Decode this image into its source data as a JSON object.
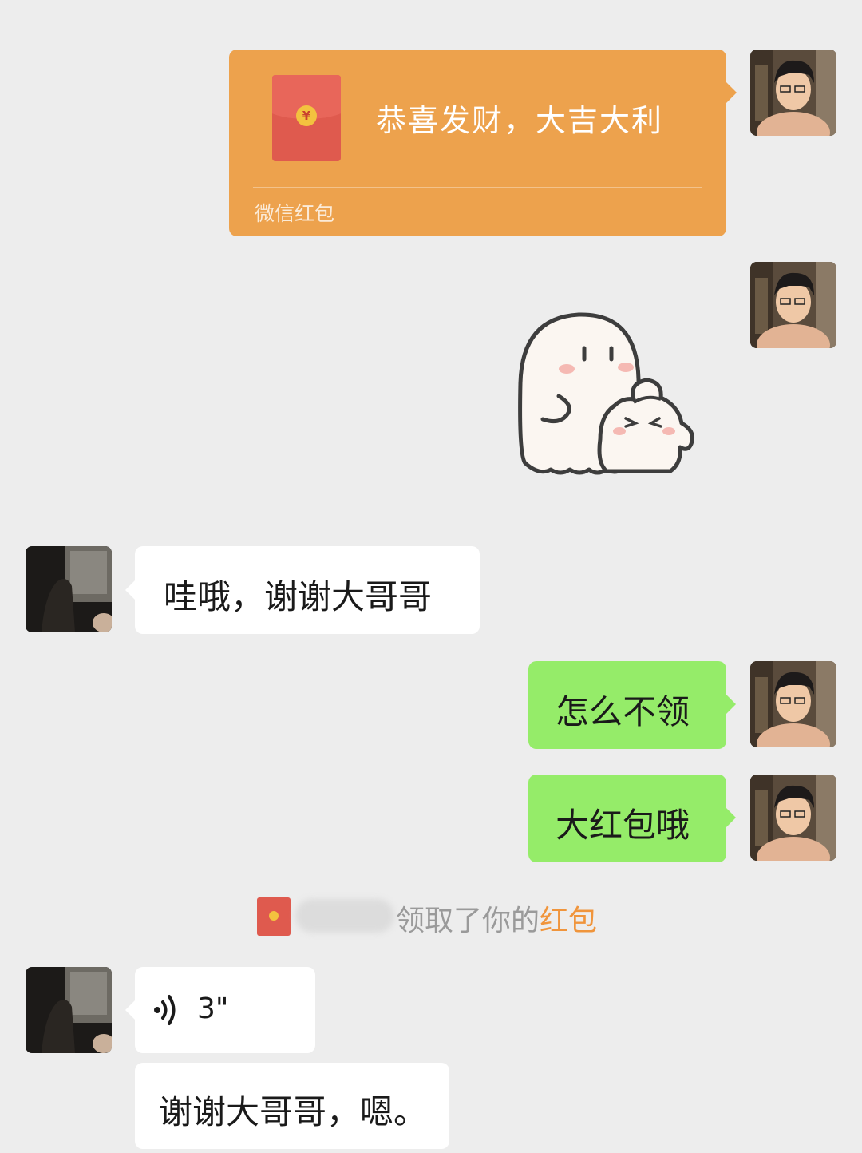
{
  "red_packet": {
    "title": "恭喜发财，大吉大利",
    "footer": "微信红包",
    "coin_symbol": "¥",
    "card_color": "#eda24d"
  },
  "sticker": {
    "icon": "ghost-sticker-icon"
  },
  "messages": {
    "m1": "哇哦，谢谢大哥哥",
    "m2": "怎么不领",
    "m3": "大红包哦",
    "m5": "谢谢大哥哥，嗯。"
  },
  "notice": {
    "text": "领取了你的",
    "link": "红包",
    "link_color": "#f0953c"
  },
  "voice": {
    "duration": "3\"",
    "icon": "voice-wave-icon"
  },
  "colors": {
    "background": "#ededed",
    "self_bubble": "#95ec69",
    "other_bubble": "#ffffff"
  }
}
